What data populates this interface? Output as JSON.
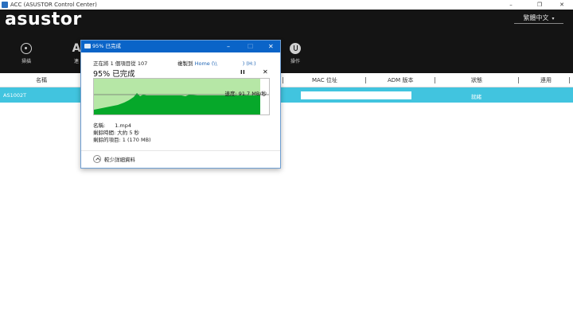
{
  "window": {
    "title": "ACC (ASUSTOR Control Center)",
    "minimize": "–",
    "restore": "❐",
    "close": "✕"
  },
  "header": {
    "logo": "asustor",
    "language": "繁體中文",
    "nav": [
      {
        "label": "掃描",
        "icon": "scan-icon"
      },
      {
        "label": "連",
        "icon": "adm-icon"
      },
      {
        "label": "操作",
        "icon": "power-icon"
      }
    ]
  },
  "table": {
    "headers": [
      "名稱",
      "MAC 位址",
      "ADM 版本",
      "狀態",
      "連用"
    ],
    "rows": [
      {
        "name": "AS1002T",
        "status": "就緒"
      }
    ]
  },
  "dialog": {
    "title": "95% 已完成",
    "progress_text": "正在將 1 個項目從 107",
    "copy_to_label": "複製到",
    "copy_to_dest": "Home (\\\\",
    "copy_to_tail": ") (H:)",
    "percent_complete": "95% 已完成",
    "percent_value": 95,
    "pause_symbol": "II",
    "cancel_symbol": "✕",
    "speed": "速度: 91.7 MB/秒",
    "name_label": "名稱:",
    "name_value": "1.mp4",
    "time_left": "剩餘時間: 大約 5 秒",
    "items_left": "剩餘的項目: 1 (170 MB)",
    "less_details": "較少詳細資料",
    "colors": {
      "accent": "#0a64c8",
      "graph_fill": "#06a82a",
      "graph_bg": "#b6e7a6"
    }
  }
}
